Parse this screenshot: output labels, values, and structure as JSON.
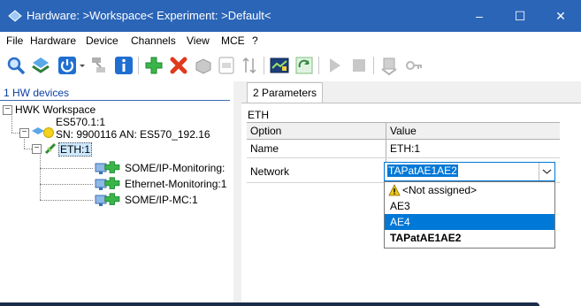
{
  "window": {
    "title": "Hardware: >Workspace<  Experiment: >Default<",
    "controls": {
      "minimize": "–",
      "maximize": "☐",
      "close": "✕"
    }
  },
  "menu": [
    "File",
    "Hardware",
    "Device",
    "Channels",
    "View",
    "MCE",
    "?"
  ],
  "toolbar": {
    "icons": [
      "search-icon",
      "network-icon",
      "power-icon",
      "disconnect-icon",
      "info-icon",
      "add-icon",
      "delete-icon",
      "device-icon",
      "module-icon",
      "sort-icon",
      "chart-icon",
      "refresh-icon",
      "play-icon",
      "stop-icon",
      "export-icon",
      "key-icon"
    ]
  },
  "left_pane": {
    "header": "1 HW devices",
    "tree": {
      "workspace": "HWK Workspace",
      "device_name": "ES570.1:1",
      "device_info": "SN: 9900116 AN: ES570_192.16",
      "eth": "ETH:1",
      "children": [
        "SOME/IP-Monitoring:",
        "Ethernet-Monitoring:1",
        "SOME/IP-MC:1"
      ]
    }
  },
  "right_pane": {
    "tab": "2 Parameters",
    "section": "ETH",
    "columns": {
      "option": "Option",
      "value": "Value"
    },
    "rows": [
      {
        "option": "Name",
        "value": "ETH:1"
      },
      {
        "option": "Network",
        "value": "TAPatAE1AE2"
      }
    ],
    "dropdown": {
      "options": [
        "<Not assigned>",
        "AE3",
        "AE4",
        "TAPatAE1AE2"
      ],
      "highlighted": "AE4",
      "current": "TAPatAE1AE2"
    }
  },
  "colors": {
    "titlebar": "#2b65b7",
    "selection": "#0078d7",
    "link": "#0b3fa8"
  }
}
